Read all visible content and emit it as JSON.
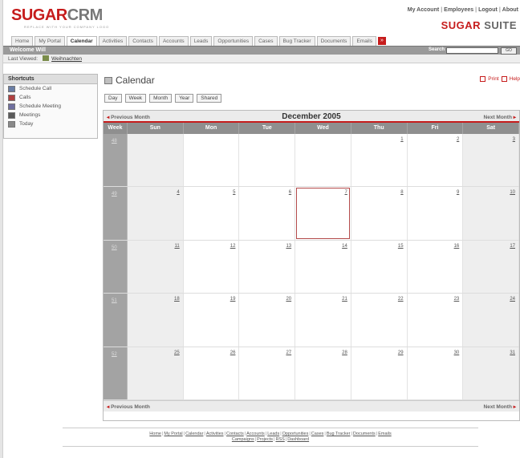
{
  "header": {
    "logo_main": "SUGAR",
    "logo_accent": "CRM",
    "logo_tagline": "REPLACE WITH YOUR COMPANY LOGO",
    "top_links": [
      "My Account",
      "Employees",
      "Logout",
      "About"
    ],
    "suite_a": "SUGAR",
    "suite_b": "SUITE"
  },
  "tabs": [
    {
      "label": "Home",
      "active": false
    },
    {
      "label": "My Portal",
      "active": false
    },
    {
      "label": "Calendar",
      "active": true
    },
    {
      "label": "Activities",
      "active": false
    },
    {
      "label": "Contacts",
      "active": false
    },
    {
      "label": "Accounts",
      "active": false
    },
    {
      "label": "Leads",
      "active": false
    },
    {
      "label": "Opportunities",
      "active": false
    },
    {
      "label": "Cases",
      "active": false
    },
    {
      "label": "Bug Tracker",
      "active": false
    },
    {
      "label": "Documents",
      "active": false
    },
    {
      "label": "Emails",
      "active": false
    }
  ],
  "welcome_bar": {
    "welcome": "Welcome Will",
    "search_label": "Search",
    "search_value": "",
    "search_button": "GO"
  },
  "last_viewed": {
    "label": "Last Viewed:",
    "item": "Weihnachten"
  },
  "shortcuts": {
    "title": "Shortcuts",
    "items": [
      {
        "label": "Schedule Call",
        "icon": "phone-icon"
      },
      {
        "label": "Calls",
        "icon": "calls-icon"
      },
      {
        "label": "Schedule Meeting",
        "icon": "meeting-icon"
      },
      {
        "label": "Meetings",
        "icon": "meetings-icon"
      },
      {
        "label": "Today",
        "icon": "today-icon"
      }
    ]
  },
  "calendar": {
    "title": "Calendar",
    "print": "Print",
    "help": "Help",
    "views": [
      "Day",
      "Week",
      "Month",
      "Year",
      "Shared"
    ],
    "prev_month": "Previous Month",
    "next_month": "Next Month",
    "month_title": "December 2005",
    "columns": [
      "Week",
      "Sun",
      "Mon",
      "Tue",
      "Wed",
      "Thu",
      "Fri",
      "Sat"
    ],
    "weeks": [
      {
        "week": "48",
        "days": [
          "",
          "",
          "",
          "",
          "1",
          "2",
          "3"
        ]
      },
      {
        "week": "49",
        "days": [
          "4",
          "5",
          "6",
          "7",
          "8",
          "9",
          "10"
        ]
      },
      {
        "week": "50",
        "days": [
          "11",
          "12",
          "13",
          "14",
          "15",
          "16",
          "17"
        ]
      },
      {
        "week": "51",
        "days": [
          "18",
          "19",
          "20",
          "21",
          "22",
          "23",
          "24"
        ]
      },
      {
        "week": "52",
        "days": [
          "25",
          "26",
          "27",
          "28",
          "29",
          "30",
          "31"
        ]
      }
    ],
    "today": "7",
    "accent_color": "#c61c1c"
  },
  "footer": {
    "line1": [
      "Home",
      "My Portal",
      "Calendar",
      "Activities",
      "Contacts",
      "Accounts",
      "Leads",
      "Opportunities",
      "Cases",
      "Bug Tracker",
      "Documents",
      "Emails"
    ],
    "line2": [
      "Campaigns",
      "Projects",
      "RSS",
      "Dashboard"
    ]
  }
}
